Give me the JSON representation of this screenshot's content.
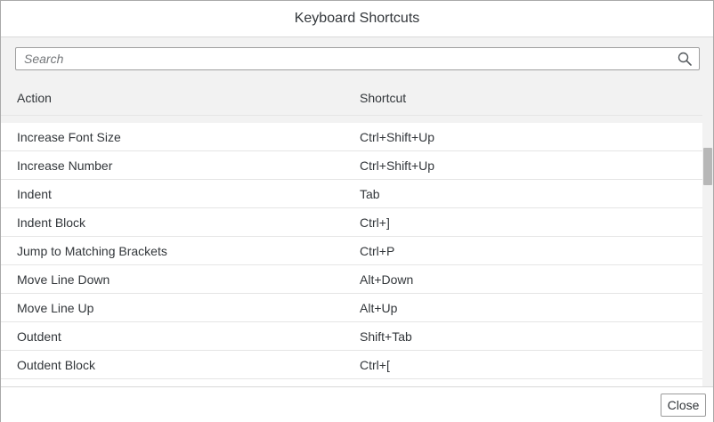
{
  "dialog": {
    "title": "Keyboard Shortcuts"
  },
  "search": {
    "placeholder": "Search",
    "value": "",
    "icon": "search-icon"
  },
  "table": {
    "columns": [
      "Action",
      "Shortcut"
    ],
    "rows": [
      {
        "action": "Increase Font Size",
        "shortcut": "Ctrl+Shift+Up"
      },
      {
        "action": "Increase Number",
        "shortcut": "Ctrl+Shift+Up"
      },
      {
        "action": "Indent",
        "shortcut": "Tab"
      },
      {
        "action": "Indent Block",
        "shortcut": "Ctrl+]"
      },
      {
        "action": "Jump to Matching Brackets",
        "shortcut": "Ctrl+P"
      },
      {
        "action": "Move Line Down",
        "shortcut": "Alt+Down"
      },
      {
        "action": "Move Line Up",
        "shortcut": "Alt+Up"
      },
      {
        "action": "Outdent",
        "shortcut": "Shift+Tab"
      },
      {
        "action": "Outdent Block",
        "shortcut": "Ctrl+["
      }
    ]
  },
  "footer": {
    "close_label": "Close"
  },
  "colors": {
    "text": "#32363a",
    "content_background": "#f2f2f2",
    "row_divider": "#e5e5e5",
    "scroll_thumb": "#b7b7b7"
  }
}
